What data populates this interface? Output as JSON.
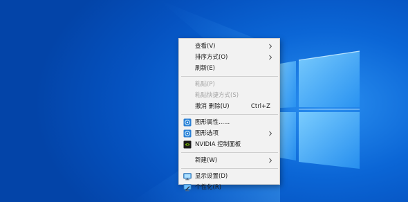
{
  "context_menu": {
    "view": {
      "label": "查看(V)"
    },
    "sort_by": {
      "label": "排序方式(O)"
    },
    "refresh": {
      "label": "刷新(E)"
    },
    "paste": {
      "label": "粘贴(P)"
    },
    "paste_shortcut": {
      "label": "粘贴快捷方式(S)"
    },
    "undo_delete": {
      "label": "撤消 删除(U)",
      "shortcut": "Ctrl+Z"
    },
    "graphics_properties": {
      "label": "图形属性......",
      "icon": "graphics-properties-icon"
    },
    "graphics_options": {
      "label": "图形选项",
      "icon": "graphics-options-icon"
    },
    "nvidia_control_panel": {
      "label": "NVIDIA 控制面板",
      "icon": "nvidia-icon"
    },
    "new": {
      "label": "新建(W)"
    },
    "display_settings": {
      "label": "显示设置(D)",
      "icon": "display-settings-icon"
    },
    "personalize": {
      "label": "个性化(R)",
      "icon": "personalize-icon"
    }
  },
  "colors": {
    "desktop_blue": "#0b66d6",
    "menu_background": "#f2f2f2",
    "disabled_text": "#a3a3a3",
    "nvidia_green": "#76b900"
  }
}
